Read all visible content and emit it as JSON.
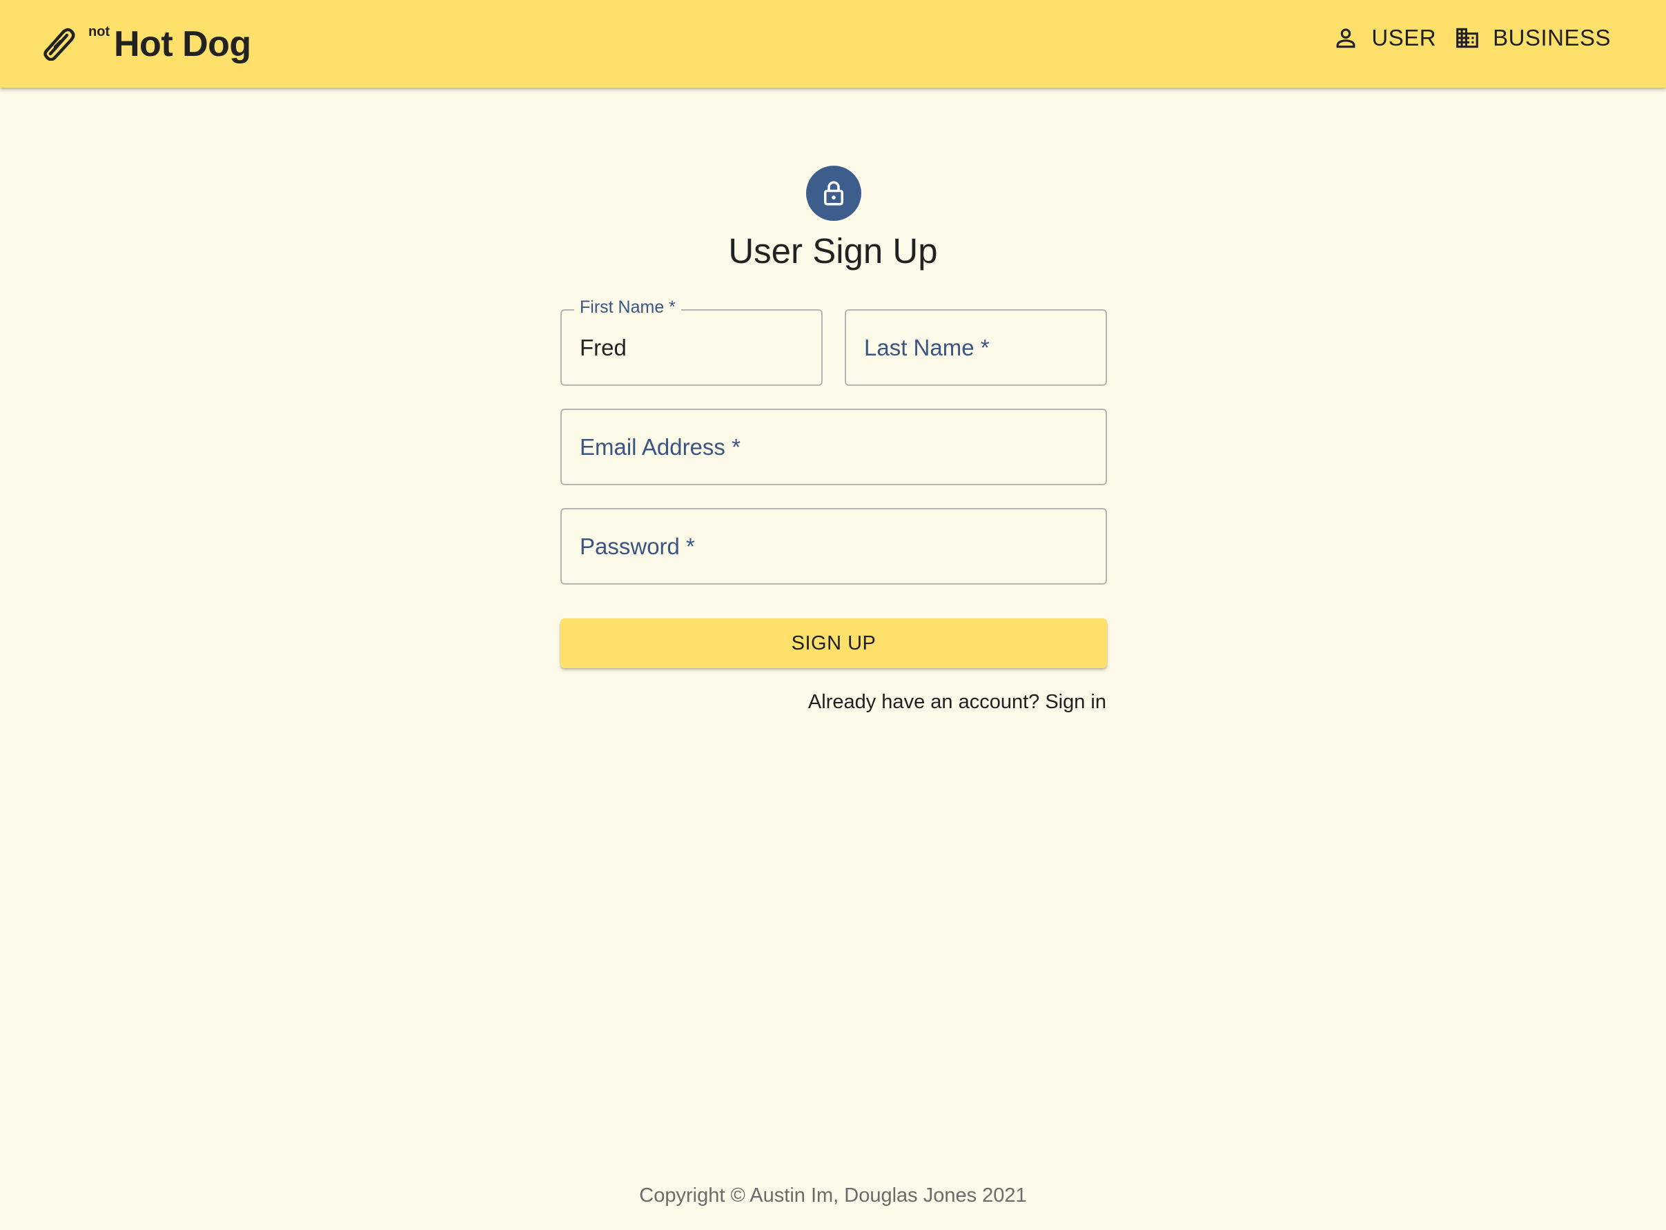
{
  "header": {
    "brand_superscript": "not",
    "brand_title": "Hot Dog",
    "nav": [
      {
        "label": "USER",
        "icon": "person-icon"
      },
      {
        "label": "BUSINESS",
        "icon": "building-icon"
      }
    ]
  },
  "form": {
    "title": "User Sign Up",
    "lock_icon": "lock-icon",
    "first_name": {
      "label": "First Name *",
      "value": "Fred"
    },
    "last_name": {
      "placeholder": "Last Name *",
      "value": ""
    },
    "email": {
      "placeholder": "Email Address *",
      "value": ""
    },
    "password": {
      "placeholder": "Password *",
      "value": ""
    },
    "submit_label": "SIGN UP",
    "signin_link": "Already have an account? Sign in"
  },
  "footer": {
    "copyright": "Copyright © Austin Im, Douglas Jones 2021"
  },
  "colors": {
    "appbar": "#ffe06b",
    "background": "#fefaea",
    "accent": "#3d5e8c",
    "label": "#3a5580"
  }
}
